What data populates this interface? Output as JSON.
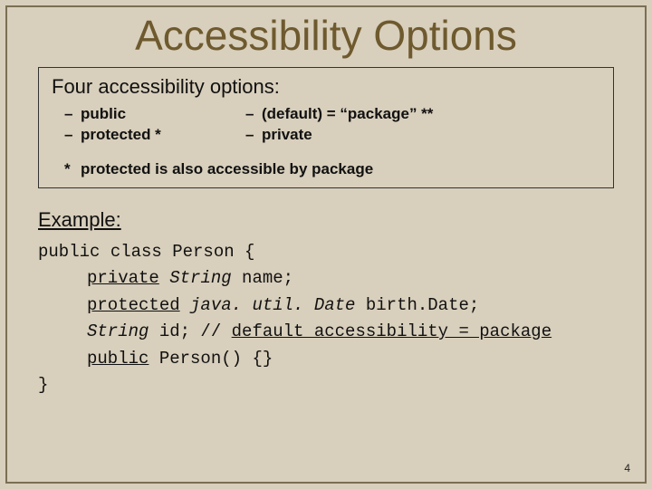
{
  "title": "Accessibility Options",
  "box": {
    "heading": "Four accessibility options:",
    "left": [
      "public",
      "protected *"
    ],
    "right": [
      "(default) = “package” **",
      "private"
    ],
    "note": "protected is also accessible by package"
  },
  "example": {
    "label": "Example:",
    "line1_a": "public class Person {",
    "line2_kw": "private",
    "line2_type": "String",
    "line2_rest": " name;",
    "line3_kw": "protected",
    "line3_type": "java. util. Date",
    "line3_rest": " birth.Date;",
    "line4_type": "String",
    "line4_mid": " id; // ",
    "line4_u": "default accessibility = package",
    "line5_kw": "public",
    "line5_rest": " Person() {}",
    "line6": "}"
  },
  "pagenum": "4"
}
